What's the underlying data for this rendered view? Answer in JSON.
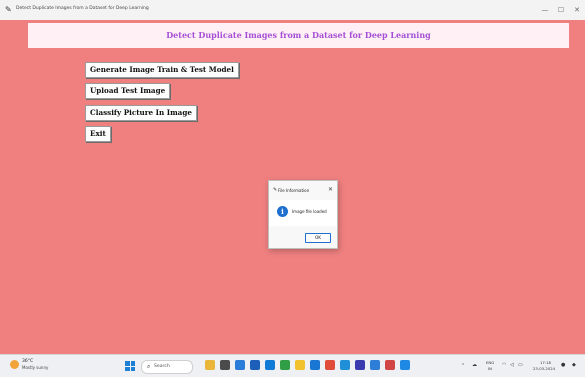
{
  "window": {
    "title": "Detect Duplicate Images from a Dataset for Deep Learning",
    "controls": {
      "minimize": "—",
      "maximize": "☐",
      "close": "✕"
    }
  },
  "app": {
    "heading": "Detect Duplicate Images from a Dataset for Deep Learning",
    "buttons": [
      {
        "label": "Generate Image Train & Test Model"
      },
      {
        "label": "Upload Test Image"
      },
      {
        "label": "Classify Picture In Image"
      },
      {
        "label": "Exit"
      }
    ],
    "colors": {
      "background": "#f08080",
      "banner": "#fff0f5",
      "heading": "#a64fd6"
    }
  },
  "dialog": {
    "title": "File Information",
    "message": "Image file loaded",
    "ok_label": "OK",
    "close_glyph": "✕",
    "icon": "info-icon"
  },
  "taskbar": {
    "weather": {
      "temp": "36°C",
      "condition": "Mostly sunny"
    },
    "search_label": "Search",
    "apps": [
      "file-explorer-icon",
      "taskview-icon",
      "edge-icon",
      "store-icon",
      "mail-icon",
      "chrome-icon",
      "folder-icon",
      "photos-icon",
      "office-icon",
      "app-icon-1",
      "app-icon-2",
      "app-icon-3",
      "app-icon-4",
      "app-icon-5"
    ],
    "tray": {
      "language_top": "ENG",
      "language_bottom": "IN",
      "time": "17:18",
      "date": "23-03-2024"
    }
  }
}
